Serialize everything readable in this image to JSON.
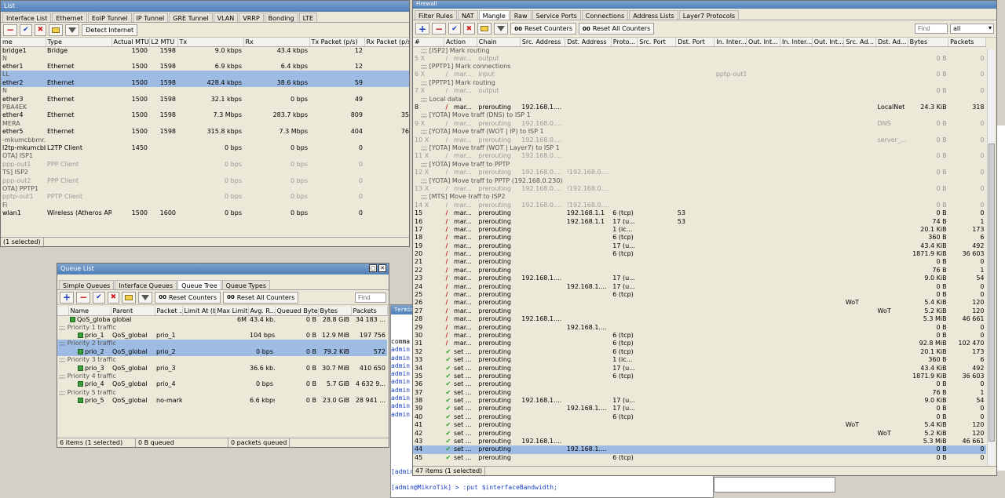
{
  "interfaces": {
    "title": "List",
    "tabs": [
      "Interface List",
      "Ethernet",
      "EoIP Tunnel",
      "IP Tunnel",
      "GRE Tunnel",
      "VLAN",
      "VRRP",
      "Bonding",
      "LTE"
    ],
    "detect_label": "Detect Internet",
    "columns": [
      "me",
      "Type",
      "Actual MTU",
      "L2 MTU",
      "Tx",
      "Rx",
      "Tx Packet (p/s)",
      "Rx Packet (p/s)"
    ],
    "rows": [
      {
        "name": "bridge1",
        "type": "Bridge",
        "mtu": "1500",
        "l2": "1598",
        "tx": "9.0 kbps",
        "rx": "43.4 kbps",
        "txp": "12",
        "rxp": ""
      },
      {
        "name": "N",
        "type": "",
        "mtu": "",
        "l2": "",
        "tx": "",
        "rx": "",
        "txp": "",
        "rxp": "",
        "cmt": true
      },
      {
        "name": "ether1",
        "type": "Ethernet",
        "mtu": "1500",
        "l2": "1598",
        "tx": "6.9 kbps",
        "rx": "6.4 kbps",
        "txp": "12",
        "rxp": ""
      },
      {
        "name": "LL",
        "type": "",
        "mtu": "",
        "l2": "",
        "tx": "",
        "rx": "",
        "txp": "",
        "rxp": "",
        "cmt": true,
        "sel": true
      },
      {
        "name": "ether2",
        "type": "Ethernet",
        "mtu": "1500",
        "l2": "1598",
        "tx": "428.4 kbps",
        "rx": "38.6 kbps",
        "txp": "59",
        "rxp": "",
        "sel": true
      },
      {
        "name": "N",
        "type": "",
        "mtu": "",
        "l2": "",
        "tx": "",
        "rx": "",
        "txp": "",
        "rxp": "",
        "cmt": true
      },
      {
        "name": "ether3",
        "type": "Ethernet",
        "mtu": "1500",
        "l2": "1598",
        "tx": "32.1 kbps",
        "rx": "0 bps",
        "txp": "49",
        "rxp": ""
      },
      {
        "name": "PBA4EK",
        "type": "",
        "mtu": "",
        "l2": "",
        "tx": "",
        "rx": "",
        "txp": "",
        "rxp": "",
        "cmt": true
      },
      {
        "name": "ether4",
        "type": "Ethernet",
        "mtu": "1500",
        "l2": "1598",
        "tx": "7.3 Mbps",
        "rx": "283.7 kbps",
        "txp": "809",
        "rxp": "35"
      },
      {
        "name": "MERA",
        "type": "",
        "mtu": "",
        "l2": "",
        "tx": "",
        "rx": "",
        "txp": "",
        "rxp": "",
        "cmt": true
      },
      {
        "name": "ether5",
        "type": "Ethernet",
        "mtu": "1500",
        "l2": "1598",
        "tx": "315.8 kbps",
        "rx": "7.3 Mbps",
        "txp": "404",
        "rxp": "76"
      },
      {
        "name": "-mkumcbbmr.ru",
        "type": "",
        "mtu": "",
        "l2": "",
        "tx": "",
        "rx": "",
        "txp": "",
        "rxp": "",
        "cmt": true
      },
      {
        "name": "l2tp-mkumcbb...",
        "type": "L2TP Client",
        "mtu": "1450",
        "l2": "",
        "tx": "0 bps",
        "rx": "0 bps",
        "txp": "0",
        "rxp": ""
      },
      {
        "name": "OTA] ISP1",
        "type": "",
        "mtu": "",
        "l2": "",
        "tx": "",
        "rx": "",
        "txp": "",
        "rxp": "",
        "cmt": true
      },
      {
        "name": "ppp-out1",
        "type": "PPP Client",
        "mtu": "",
        "l2": "",
        "tx": "0 bps",
        "rx": "0 bps",
        "txp": "0",
        "rxp": "",
        "dis": true
      },
      {
        "name": "TS] ISP2",
        "type": "",
        "mtu": "",
        "l2": "",
        "tx": "",
        "rx": "",
        "txp": "",
        "rxp": "",
        "cmt": true
      },
      {
        "name": "ppp-out2",
        "type": "PPP Client",
        "mtu": "",
        "l2": "",
        "tx": "0 bps",
        "rx": "0 bps",
        "txp": "0",
        "rxp": "",
        "dis": true
      },
      {
        "name": "OTA] PPTP1",
        "type": "",
        "mtu": "",
        "l2": "",
        "tx": "",
        "rx": "",
        "txp": "",
        "rxp": "",
        "cmt": true
      },
      {
        "name": "pptp-out1",
        "type": "PPTP Client",
        "mtu": "",
        "l2": "",
        "tx": "0 bps",
        "rx": "0 bps",
        "txp": "0",
        "rxp": "",
        "dis": true
      },
      {
        "name": "Fi",
        "type": "",
        "mtu": "",
        "l2": "",
        "tx": "",
        "rx": "",
        "txp": "",
        "rxp": "",
        "cmt": true
      },
      {
        "name": "wlan1",
        "type": "Wireless (Atheros AR9...",
        "mtu": "1500",
        "l2": "1600",
        "tx": "0 bps",
        "rx": "0 bps",
        "txp": "0",
        "rxp": ""
      }
    ],
    "status": "(1 selected)"
  },
  "queues": {
    "title": "Queue List",
    "tabs": [
      "Simple Queues",
      "Interface Queues",
      "Queue Tree",
      "Queue Types"
    ],
    "reset_label": "Reset Counters",
    "reset_all_label": "Reset All Counters",
    "find_placeholder": "Find",
    "columns": [
      "Name",
      "Parent",
      "Packet ...",
      "Limit At (b...",
      "Max Limit ...",
      "Avg. R...",
      "Queued Bytes",
      "Bytes",
      "Packets"
    ],
    "rows": [
      {
        "name": "QoS_global",
        "parent": "global",
        "mark": "",
        "limit": "",
        "max": "6M",
        "avg": "43.4 kb...",
        "queued": "0 B",
        "bytes": "28.8 GiB",
        "packets": "34 183 ..."
      },
      {
        "name": ";;; Priority 1 traffic",
        "cmt": true
      },
      {
        "name": "prio_1",
        "parent": "QoS_global",
        "mark": "prio_1",
        "limit": "",
        "max": "",
        "avg": "104 bps",
        "queued": "0 B",
        "bytes": "12.9 MiB",
        "packets": "197 756"
      },
      {
        "name": ";;; Priority 2 traffic",
        "cmt": true,
        "sel": true
      },
      {
        "name": "prio_2",
        "parent": "QoS_global",
        "mark": "prio_2",
        "limit": "",
        "max": "",
        "avg": "0 bps",
        "queued": "0 B",
        "bytes": "79.2 KiB",
        "packets": "572",
        "sel": true
      },
      {
        "name": ";;; Priority 3 traffic",
        "cmt": true
      },
      {
        "name": "prio_3",
        "parent": "QoS_global",
        "mark": "prio_3",
        "limit": "",
        "max": "",
        "avg": "36.6 kb...",
        "queued": "0 B",
        "bytes": "30.7 MiB",
        "packets": "410 650"
      },
      {
        "name": ";;; Priority 4 traffic",
        "cmt": true
      },
      {
        "name": "prio_4",
        "parent": "QoS_global",
        "mark": "prio_4",
        "limit": "",
        "max": "",
        "avg": "0 bps",
        "queued": "0 B",
        "bytes": "5.7 GiB",
        "packets": "4 632 9..."
      },
      {
        "name": ";;; Priority 5 traffic",
        "cmt": true
      },
      {
        "name": "prio_5",
        "parent": "QoS_global",
        "mark": "no-mark",
        "limit": "",
        "max": "",
        "avg": "6.6 kbps",
        "queued": "0 B",
        "bytes": "23.0 GiB",
        "packets": "28 941 ..."
      }
    ],
    "status": [
      "6 items (1 selected)",
      "0 B queued",
      "0 packets queued"
    ]
  },
  "firewall": {
    "title": "Firewall",
    "tabs": [
      "Filter Rules",
      "NAT",
      "Mangle",
      "Raw",
      "Service Ports",
      "Connections",
      "Address Lists",
      "Layer7 Protocols"
    ],
    "reset_label": "Reset Counters",
    "reset_all_label": "Reset All Counters",
    "find_placeholder": "Find",
    "filter_value": "all",
    "columns": [
      "#",
      "Action",
      "Chain",
      "Src. Address",
      "Dst. Address",
      "Proto...",
      "Src. Port",
      "Dst. Port",
      "In. Inter...",
      "Out. Int...",
      "In. Inter...",
      "Out. Int...",
      "Src. Ad...",
      "Dst. Ad...",
      "Bytes",
      "Packets"
    ],
    "rows": [
      {
        "c": ";;; [ISP2] Mark routing"
      },
      {
        "n": "5",
        "x": "X",
        "a": "mar...",
        "ch": "output",
        "b": "0 B",
        "p": "0",
        "dis": true
      },
      {
        "c": ";;; [PPTP1] Mark connections"
      },
      {
        "n": "6",
        "x": "X",
        "a": "mar...",
        "ch": "input",
        "ii": "pptp-out1",
        "b": "0 B",
        "p": "0",
        "dis": true
      },
      {
        "c": ";;; [PPTP1] Mark routing"
      },
      {
        "n": "7",
        "x": "X",
        "a": "mar...",
        "ch": "output",
        "b": "0 B",
        "p": "0",
        "dis": true
      },
      {
        "c": ";;; Local data"
      },
      {
        "n": "8",
        "a": "mar...",
        "ch": "prerouting",
        "src": "192.168.1....",
        "dl": "LocalNet",
        "b": "24.3 KiB",
        "p": "318"
      },
      {
        "c": ";;; [YOTA] Move traff (DNS) to ISP 1"
      },
      {
        "n": "9",
        "x": "X",
        "a": "mar...",
        "ch": "prerouting",
        "src": "192.168.0....",
        "dl": "DNS",
        "b": "0 B",
        "p": "0",
        "dis": true
      },
      {
        "c": ";;; [YOTA] Move traff (WOT | IP) to ISP 1"
      },
      {
        "n": "10",
        "x": "X",
        "a": "mar...",
        "ch": "prerouting",
        "src": "192.168.0....",
        "dl": "server_...",
        "b": "0 B",
        "p": "0",
        "dis": true
      },
      {
        "c": ";;; [YOTA] Move traff (WOT | Layer7) to ISP 1"
      },
      {
        "n": "11",
        "x": "X",
        "a": "mar...",
        "ch": "prerouting",
        "src": "192.168.0....",
        "b": "0 B",
        "p": "0",
        "dis": true
      },
      {
        "c": ";;; [YOTA] Move traff to PPTP"
      },
      {
        "n": "12",
        "x": "X",
        "a": "mar...",
        "ch": "prerouting",
        "src": "192.168.0....",
        "dst": "!192.168.0....",
        "b": "0 B",
        "p": "0",
        "dis": true
      },
      {
        "c": ";;; [YOTA] Move traff to PPTP (192.168.0.230)"
      },
      {
        "n": "13",
        "x": "X",
        "a": "mar...",
        "ch": "prerouting",
        "src": "192.168.0....",
        "dst": "!192.168.0....",
        "b": "0 B",
        "p": "0",
        "dis": true
      },
      {
        "c": ";;; [MTS] Move traff to ISP2"
      },
      {
        "n": "14",
        "x": "X",
        "a": "mar...",
        "ch": "prerouting",
        "src": "192.168.0....",
        "dst": "!192.168.0....",
        "b": "0 B",
        "p": "0",
        "dis": true
      },
      {
        "n": "15",
        "a": "mar...",
        "ch": "prerouting",
        "dst": "192.168.1.1",
        "pr": "6 (tcp)",
        "dp": "53",
        "b": "0 B",
        "p": "0"
      },
      {
        "n": "16",
        "a": "mar...",
        "ch": "prerouting",
        "dst": "192.168.1.1",
        "pr": "17 (u...",
        "dp": "53",
        "b": "74 B",
        "p": "1"
      },
      {
        "n": "17",
        "a": "mar...",
        "ch": "prerouting",
        "pr": "1 (ic...",
        "b": "20.1 KiB",
        "p": "173"
      },
      {
        "n": "18",
        "a": "mar...",
        "ch": "prerouting",
        "pr": "6 (tcp)",
        "b": "360 B",
        "p": "6"
      },
      {
        "n": "19",
        "a": "mar...",
        "ch": "prerouting",
        "pr": "17 (u...",
        "b": "43.4 KiB",
        "p": "492"
      },
      {
        "n": "20",
        "a": "mar...",
        "ch": "prerouting",
        "pr": "6 (tcp)",
        "b": "1871.9 KiB",
        "p": "36 603"
      },
      {
        "n": "21",
        "a": "mar...",
        "ch": "prerouting",
        "b": "0 B",
        "p": "0"
      },
      {
        "n": "22",
        "a": "mar...",
        "ch": "prerouting",
        "b": "76 B",
        "p": "1"
      },
      {
        "n": "23",
        "a": "mar...",
        "ch": "prerouting",
        "src": "192.168.1....",
        "pr": "17 (u...",
        "b": "9.0 KiB",
        "p": "54"
      },
      {
        "n": "24",
        "a": "mar...",
        "ch": "prerouting",
        "dst": "192.168.1....",
        "pr": "17 (u...",
        "b": "0 B",
        "p": "0"
      },
      {
        "n": "25",
        "a": "mar...",
        "ch": "prerouting",
        "pr": "6 (tcp)",
        "b": "0 B",
        "p": "0"
      },
      {
        "n": "26",
        "a": "mar...",
        "ch": "prerouting",
        "sl": "WoT",
        "b": "5.4 KiB",
        "p": "120"
      },
      {
        "n": "27",
        "a": "mar...",
        "ch": "prerouting",
        "dl": "WoT",
        "b": "5.2 KiB",
        "p": "120"
      },
      {
        "n": "28",
        "a": "mar...",
        "ch": "prerouting",
        "src": "192.168.1....",
        "b": "5.3 MiB",
        "p": "46 661"
      },
      {
        "n": "29",
        "a": "mar...",
        "ch": "prerouting",
        "dst": "192.168.1....",
        "b": "0 B",
        "p": "0"
      },
      {
        "n": "30",
        "a": "mar...",
        "ch": "prerouting",
        "pr": "6 (tcp)",
        "b": "0 B",
        "p": "0"
      },
      {
        "n": "31",
        "a": "mar...",
        "ch": "prerouting",
        "pr": "6 (tcp)",
        "b": "92.8 MiB",
        "p": "102 470"
      },
      {
        "n": "32",
        "a": "set ...",
        "ch": "prerouting",
        "pr": "6 (tcp)",
        "b": "20.1 KiB",
        "p": "173",
        "set": true
      },
      {
        "n": "33",
        "a": "set ...",
        "ch": "prerouting",
        "pr": "1 (ic...",
        "b": "360 B",
        "p": "6",
        "set": true
      },
      {
        "n": "34",
        "a": "set ...",
        "ch": "prerouting",
        "pr": "17 (u...",
        "b": "43.4 KiB",
        "p": "492",
        "set": true
      },
      {
        "n": "35",
        "a": "set ...",
        "ch": "prerouting",
        "pr": "6 (tcp)",
        "b": "1871.9 KiB",
        "p": "36 603",
        "set": true
      },
      {
        "n": "36",
        "a": "set ...",
        "ch": "prerouting",
        "b": "0 B",
        "p": "0",
        "set": true
      },
      {
        "n": "37",
        "a": "set ...",
        "ch": "prerouting",
        "b": "76 B",
        "p": "1",
        "set": true
      },
      {
        "n": "38",
        "a": "set ...",
        "ch": "prerouting",
        "src": "192.168.1....",
        "pr": "17 (u...",
        "b": "9.0 KiB",
        "p": "54",
        "set": true
      },
      {
        "n": "39",
        "a": "set ...",
        "ch": "prerouting",
        "dst": "192.168.1....",
        "pr": "17 (u...",
        "b": "0 B",
        "p": "0",
        "set": true
      },
      {
        "n": "40",
        "a": "set ...",
        "ch": "prerouting",
        "pr": "6 (tcp)",
        "b": "0 B",
        "p": "0",
        "set": true
      },
      {
        "n": "41",
        "a": "set ...",
        "ch": "prerouting",
        "sl": "WoT",
        "b": "5.4 KiB",
        "p": "120",
        "set": true
      },
      {
        "n": "42",
        "a": "set ...",
        "ch": "prerouting",
        "dl": "WoT",
        "b": "5.2 KiB",
        "p": "120",
        "set": true
      },
      {
        "n": "43",
        "a": "set ...",
        "ch": "prerouting",
        "src": "192.168.1....",
        "b": "5.3 MiB",
        "p": "46 661",
        "set": true
      },
      {
        "n": "44",
        "a": "set ...",
        "ch": "prerouting",
        "dst": "192.168.1....",
        "b": "0 B",
        "p": "0",
        "set": true,
        "sel": true
      },
      {
        "n": "45",
        "a": "set ...",
        "ch": "prerouting",
        "pr": "6 (tcp)",
        "b": "0 B",
        "p": "0",
        "set": true
      }
    ],
    "status": "47 items (1 selected)"
  },
  "terminal": {
    "title": "Terminal",
    "lines": [
      {
        "text": "comma"
      },
      {
        "text": "admin",
        "p": true
      },
      {
        "text": "admin",
        "p": true
      },
      {
        "text": "admin",
        "p": true
      },
      {
        "text": "admin",
        "p": true
      },
      {
        "text": "admin",
        "p": true
      },
      {
        "text": "admin",
        "p": true
      },
      {
        "text": "admin",
        "p": true
      },
      {
        "text": "admin",
        "p": true
      },
      {
        "text": "admin",
        "p": true
      }
    ],
    "prompt_lines": [
      "[admin@MikroTik] > :put $i",
      "[admin@MikroTik] > :put $interfaceBandwidth;"
    ]
  },
  "icons": {
    "green": "#2aa02a",
    "red": "#c01818",
    "accent": "#1a3fbf",
    "selected": "#9dbbe3"
  }
}
